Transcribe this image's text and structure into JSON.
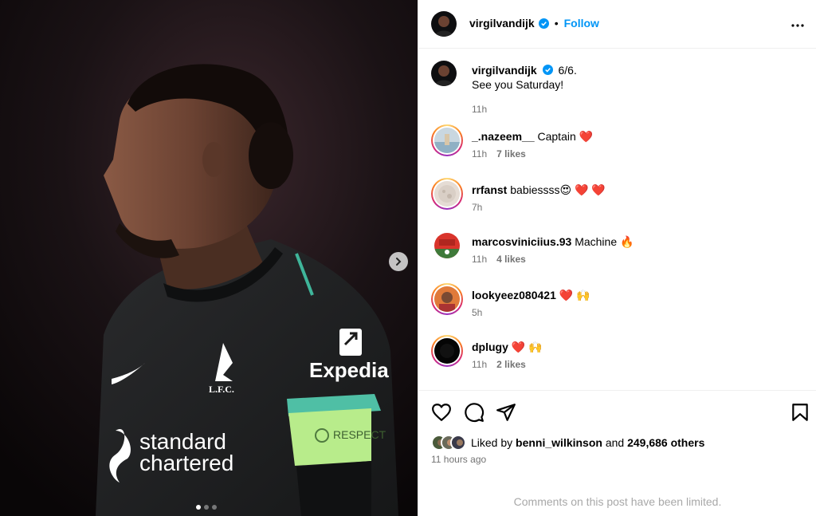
{
  "post_header": {
    "username": "virgilvandijk",
    "separator": "•",
    "follow_label": "Follow"
  },
  "caption": {
    "username": "virgilvandijk",
    "text_line1": "6/6.",
    "text_line2": "See you Saturday!",
    "time": "11h"
  },
  "media": {
    "jersey_sponsor_line1": "standard",
    "jersey_sponsor_line2": "chartered",
    "sleeve_sponsor": "Expedia",
    "club_crest": "L.F.C.",
    "armband_text": "RESPECT",
    "current_slide": 1,
    "total_slides": 3
  },
  "comments": [
    {
      "username": "_.nazeem__",
      "text": "Captain ❤️",
      "time": "11h",
      "likes": "7 likes",
      "ring": true
    },
    {
      "username": "rrfanst",
      "text": "babiessss😍 ❤️ ❤️",
      "time": "7h",
      "likes": "",
      "ring": true
    },
    {
      "username": "marcosviniciius.93",
      "text": "Machine 🔥",
      "time": "11h",
      "likes": "4 likes",
      "ring": false
    },
    {
      "username": "lookyeez080421",
      "text": "❤️ 🙌",
      "time": "5h",
      "likes": "",
      "ring": true
    },
    {
      "username": "dplugy",
      "text": "❤️ 🙌",
      "time": "11h",
      "likes": "2 likes",
      "ring": true
    }
  ],
  "likes_summary": {
    "prefix": "Liked by",
    "first_user": "benni_wilkinson",
    "connector": "and",
    "others": "249,686 others"
  },
  "post_time": "11 hours ago",
  "comments_limited": "Comments on this post have been limited.",
  "icons": [
    "verified-badge-icon",
    "more-options-icon",
    "heart-icon",
    "comment-icon",
    "share-icon",
    "bookmark-icon",
    "chevron-right-icon"
  ],
  "colors": {
    "accent": "#0095f6",
    "muted": "#737373",
    "border": "#efefef",
    "heart_red": "#ff3040"
  }
}
